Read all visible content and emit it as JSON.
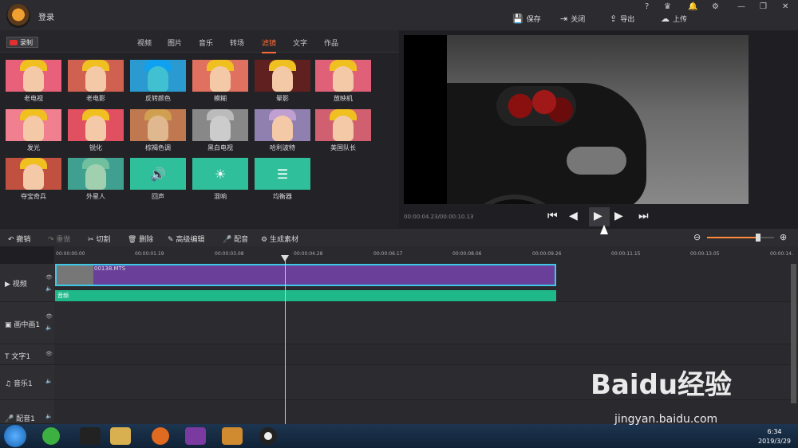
{
  "header": {
    "login": "登录",
    "actions": [
      "保存",
      "关闭",
      "导出",
      "上传"
    ],
    "icons": [
      "help-icon",
      "vip-icon",
      "bell-icon",
      "gear-icon",
      "minimize-icon",
      "maximize-icon",
      "close-icon"
    ]
  },
  "record": {
    "label": "录制"
  },
  "tabs": [
    "视频",
    "图片",
    "音乐",
    "转场",
    "滤镜",
    "文字",
    "作品"
  ],
  "active_tab": "滤镜",
  "filters": [
    "老电视",
    "老电影",
    "反转颜色",
    "模糊",
    "晕影",
    "放映机",
    "发光",
    "锐化",
    "棕褐色调",
    "黑白电视",
    "哈利波特",
    "美国队长",
    "夺宝奇兵",
    "外星人",
    "回声",
    "混响",
    "均衡器"
  ],
  "timecode": "00:00:04.23/00:00:10.13",
  "edit": [
    "撤销",
    "重做",
    "切割",
    "删除",
    "高级编辑",
    "配音",
    "生成素材"
  ],
  "ruler": [
    "00:00:00.00",
    "00:00:01.19",
    "00:00:03.08",
    "00:00:04.28",
    "00:00:06.17",
    "00:00:08.06",
    "00:00:09.26",
    "00:00:11.15",
    "00:00:13.05",
    "00:00:14."
  ],
  "tracks": [
    "视频",
    "画中画1",
    "文字1",
    "音乐1",
    "配音1"
  ],
  "clip": {
    "name": "00138.MTS",
    "audio": "音频"
  },
  "taskbar": {
    "time": "6:34",
    "date": "2019/3/29"
  },
  "watermark": {
    "brand": "Baidu经验",
    "url": "jingyan.baidu.com"
  }
}
